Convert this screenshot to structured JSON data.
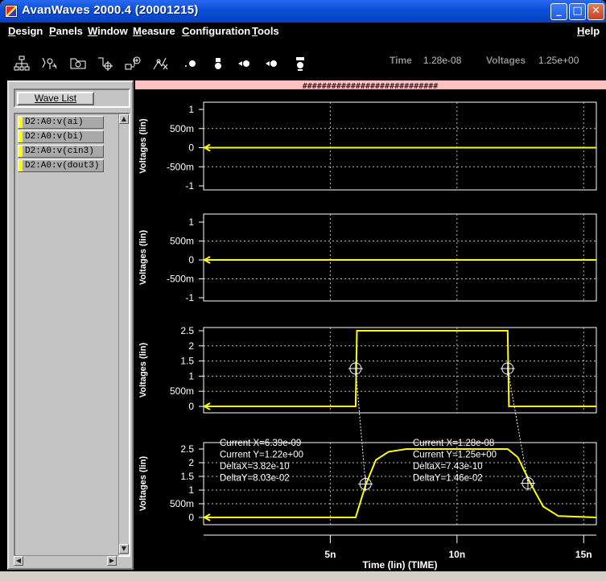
{
  "window": {
    "title": "AvanWaves 2000.4  (20001215)",
    "minimize_glyph": "_",
    "maximize_glyph": "□",
    "close_glyph": "✕"
  },
  "menubar": {
    "items": [
      "Design",
      "Panels",
      "Window",
      "Measure",
      "Configuration",
      "Tools"
    ],
    "help": "Help"
  },
  "toolbar": {
    "icons": [
      "hierarchy-icon",
      "wave-tree-icon",
      "open-design-icon",
      "cursor-cross-icon",
      "add-wave-icon",
      "measure-icon",
      "zoom-in-icon",
      "zoom-out-icon",
      "pan-left-icon",
      "pan-right-icon",
      "fit-icon"
    ],
    "time_label": "Time",
    "time_value": "1.28e-08",
    "voltages_label": "Voltages",
    "voltages_value": "1.25e+00"
  },
  "wave_list": {
    "button_label": "Wave List",
    "items": [
      "D2:A0:v(ai)",
      "D2:A0:v(bi)",
      "D2:A0:v(cin3)",
      "D2:A0:v(dout3)"
    ]
  },
  "plot": {
    "banner": "############################",
    "trace_color": "#ffff00",
    "panels": [
      {
        "ylabel": "Voltages (lin)",
        "yticks": [
          "1",
          "500m",
          "0",
          "-500m",
          "-1"
        ]
      },
      {
        "ylabel": "Voltages (lin)",
        "yticks": [
          "1",
          "500m",
          "0",
          "-500m",
          "-1"
        ]
      },
      {
        "ylabel": "Voltages (lin)",
        "yticks": [
          "2.5",
          "2",
          "1.5",
          "1",
          "500m",
          "0"
        ]
      },
      {
        "ylabel": "Voltages (lin)",
        "yticks": [
          "2.5",
          "2",
          "1.5",
          "1",
          "500m",
          "0"
        ]
      }
    ],
    "xticks": [
      "5n",
      "10n",
      "15n"
    ],
    "xlabel": "Time (lin) (TIME)",
    "measurements": [
      {
        "current_x": "Current X=6.39e-09",
        "current_y": "Current Y=1.22e+00",
        "delta_x": "DeltaX=3.82e-10",
        "delta_y": "DeltaY=8.03e-02"
      },
      {
        "current_x": "Current X=1.28e-08",
        "current_y": "Current Y=1.25e+00",
        "delta_x": "DeltaX=7.43e-10",
        "delta_y": "DeltaY=1.46e-02"
      }
    ]
  },
  "chart_data": {
    "type": "line",
    "xlim": [
      0,
      15.5
    ],
    "x_unit": "ns",
    "series": [
      {
        "name": "D2:A0:v(ai)",
        "x": [
          0,
          15.5
        ],
        "y": [
          0,
          0
        ]
      },
      {
        "name": "D2:A0:v(bi)",
        "x": [
          0,
          15.5
        ],
        "y": [
          0,
          0
        ]
      },
      {
        "name": "D2:A0:v(cin3)",
        "x": [
          0,
          6.0,
          6.05,
          12.0,
          12.05,
          15.5
        ],
        "y": [
          0,
          0,
          2.5,
          2.5,
          0,
          0
        ]
      },
      {
        "name": "D2:A0:v(dout3)",
        "x": [
          0,
          6.0,
          6.4,
          6.8,
          7.3,
          8.0,
          9.0,
          12.0,
          12.4,
          12.9,
          13.4,
          14.0,
          15.5
        ],
        "y": [
          0,
          0,
          1.2,
          2.1,
          2.4,
          2.5,
          2.5,
          2.5,
          2.2,
          1.25,
          0.4,
          0.05,
          0
        ]
      }
    ],
    "panel_ylims": [
      [
        -1,
        1
      ],
      [
        -1,
        1
      ],
      [
        0,
        2.5
      ],
      [
        0,
        2.5
      ]
    ],
    "cursor_points": [
      {
        "panel": 3,
        "x": 6.0,
        "y": 1.25
      },
      {
        "panel": 3,
        "x": 12.0,
        "y": 1.25
      },
      {
        "panel": 4,
        "x": 6.39,
        "y": 1.22
      },
      {
        "panel": 4,
        "x": 12.8,
        "y": 1.25
      }
    ],
    "grid": true
  }
}
